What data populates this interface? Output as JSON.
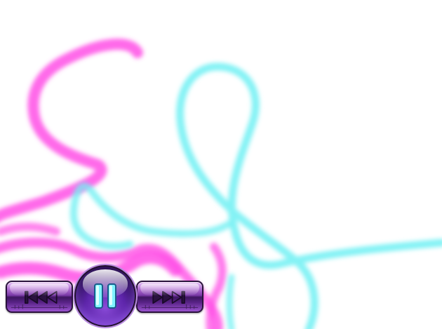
{
  "player": {
    "controls": [
      {
        "name": "previous",
        "icon": "skip-back-icon"
      },
      {
        "name": "play-pause",
        "icon": "pause-icon"
      },
      {
        "name": "next",
        "icon": "skip-forward-icon"
      }
    ]
  },
  "theme": {
    "stroke_magenta": "#ff4fe6",
    "stroke_cyan": "#6ff0f3",
    "button_purple": "#6a2fa3",
    "glyph_cyan": "#3fe0f5"
  }
}
